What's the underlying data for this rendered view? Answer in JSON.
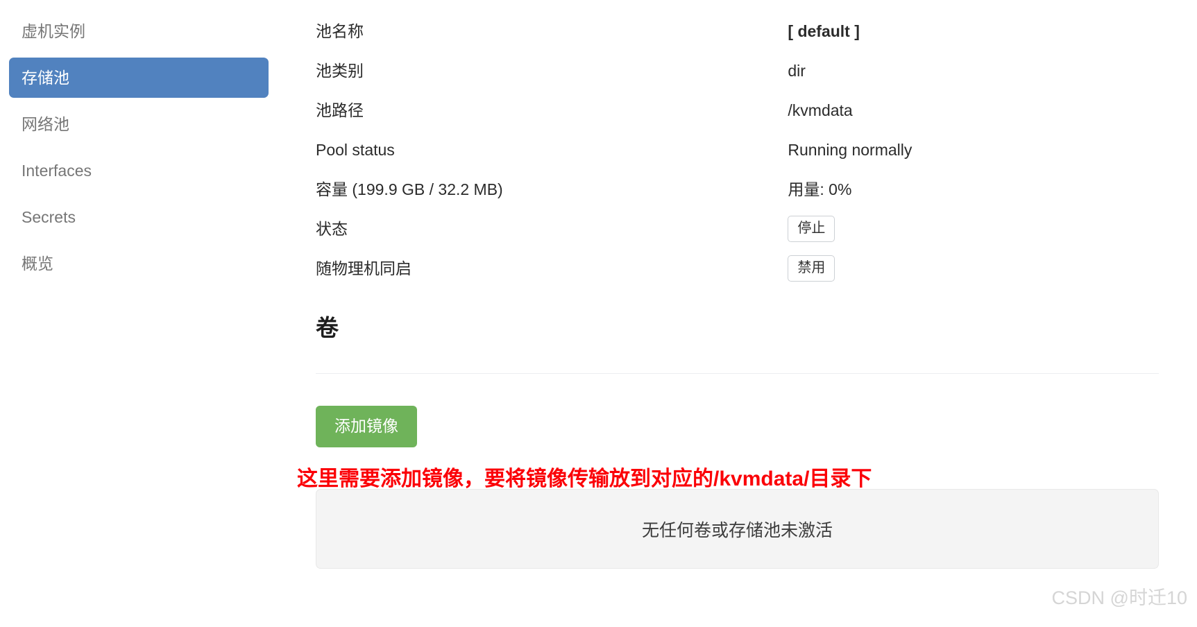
{
  "sidebar": {
    "items": [
      {
        "label": "虚机实例",
        "active": false
      },
      {
        "label": "存储池",
        "active": true
      },
      {
        "label": "网络池",
        "active": false
      },
      {
        "label": "Interfaces",
        "active": false
      },
      {
        "label": "Secrets",
        "active": false
      },
      {
        "label": "概览",
        "active": false
      }
    ]
  },
  "details": {
    "rows": [
      {
        "label": "池名称",
        "value": "[ default ]",
        "value_style": "bold"
      },
      {
        "label": "池类别",
        "value": "dir",
        "value_style": "plain"
      },
      {
        "label": "池路径",
        "value": "/kvmdata",
        "value_style": "plain"
      },
      {
        "label": "Pool status",
        "value": "Running normally",
        "value_style": "plain"
      },
      {
        "label": "容量 (199.9 GB / 32.2 MB)",
        "value": "用量: 0%",
        "value_style": "plain"
      },
      {
        "label": "状态",
        "value": "停止",
        "value_style": "button"
      },
      {
        "label": "随物理机同启",
        "value": "禁用",
        "value_style": "button"
      }
    ]
  },
  "volumes": {
    "title": "卷",
    "add_image_button": "添加镜像",
    "empty_message": "无任何卷或存储池未激活"
  },
  "annotation": {
    "text": "这里需要添加镜像，要将镜像传输放到对应的/kvmdata/目录下",
    "color": "#fb0007"
  },
  "watermark": {
    "text": "CSDN @时迁10"
  },
  "colors": {
    "sidebar_active_bg": "#5182bf",
    "add_button_bg": "#6fb35a",
    "panel_bg": "#f4f4f4"
  }
}
